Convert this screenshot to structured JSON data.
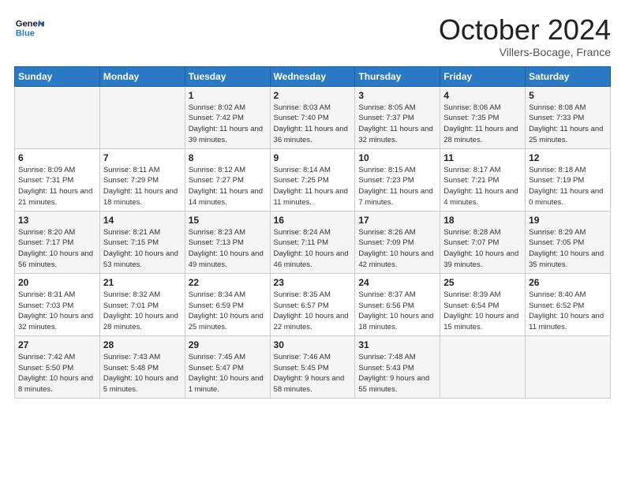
{
  "header": {
    "logo_line1": "General",
    "logo_line2": "Blue",
    "month_title": "October 2024",
    "subtitle": "Villers-Bocage, France"
  },
  "weekdays": [
    "Sunday",
    "Monday",
    "Tuesday",
    "Wednesday",
    "Thursday",
    "Friday",
    "Saturday"
  ],
  "weeks": [
    [
      {
        "day": "",
        "info": ""
      },
      {
        "day": "",
        "info": ""
      },
      {
        "day": "1",
        "info": "Sunrise: 8:02 AM\nSunset: 7:42 PM\nDaylight: 11 hours and 39 minutes."
      },
      {
        "day": "2",
        "info": "Sunrise: 8:03 AM\nSunset: 7:40 PM\nDaylight: 11 hours and 36 minutes."
      },
      {
        "day": "3",
        "info": "Sunrise: 8:05 AM\nSunset: 7:37 PM\nDaylight: 11 hours and 32 minutes."
      },
      {
        "day": "4",
        "info": "Sunrise: 8:06 AM\nSunset: 7:35 PM\nDaylight: 11 hours and 28 minutes."
      },
      {
        "day": "5",
        "info": "Sunrise: 8:08 AM\nSunset: 7:33 PM\nDaylight: 11 hours and 25 minutes."
      }
    ],
    [
      {
        "day": "6",
        "info": "Sunrise: 8:09 AM\nSunset: 7:31 PM\nDaylight: 11 hours and 21 minutes."
      },
      {
        "day": "7",
        "info": "Sunrise: 8:11 AM\nSunset: 7:29 PM\nDaylight: 11 hours and 18 minutes."
      },
      {
        "day": "8",
        "info": "Sunrise: 8:12 AM\nSunset: 7:27 PM\nDaylight: 11 hours and 14 minutes."
      },
      {
        "day": "9",
        "info": "Sunrise: 8:14 AM\nSunset: 7:25 PM\nDaylight: 11 hours and 11 minutes."
      },
      {
        "day": "10",
        "info": "Sunrise: 8:15 AM\nSunset: 7:23 PM\nDaylight: 11 hours and 7 minutes."
      },
      {
        "day": "11",
        "info": "Sunrise: 8:17 AM\nSunset: 7:21 PM\nDaylight: 11 hours and 4 minutes."
      },
      {
        "day": "12",
        "info": "Sunrise: 8:18 AM\nSunset: 7:19 PM\nDaylight: 11 hours and 0 minutes."
      }
    ],
    [
      {
        "day": "13",
        "info": "Sunrise: 8:20 AM\nSunset: 7:17 PM\nDaylight: 10 hours and 56 minutes."
      },
      {
        "day": "14",
        "info": "Sunrise: 8:21 AM\nSunset: 7:15 PM\nDaylight: 10 hours and 53 minutes."
      },
      {
        "day": "15",
        "info": "Sunrise: 8:23 AM\nSunset: 7:13 PM\nDaylight: 10 hours and 49 minutes."
      },
      {
        "day": "16",
        "info": "Sunrise: 8:24 AM\nSunset: 7:11 PM\nDaylight: 10 hours and 46 minutes."
      },
      {
        "day": "17",
        "info": "Sunrise: 8:26 AM\nSunset: 7:09 PM\nDaylight: 10 hours and 42 minutes."
      },
      {
        "day": "18",
        "info": "Sunrise: 8:28 AM\nSunset: 7:07 PM\nDaylight: 10 hours and 39 minutes."
      },
      {
        "day": "19",
        "info": "Sunrise: 8:29 AM\nSunset: 7:05 PM\nDaylight: 10 hours and 35 minutes."
      }
    ],
    [
      {
        "day": "20",
        "info": "Sunrise: 8:31 AM\nSunset: 7:03 PM\nDaylight: 10 hours and 32 minutes."
      },
      {
        "day": "21",
        "info": "Sunrise: 8:32 AM\nSunset: 7:01 PM\nDaylight: 10 hours and 28 minutes."
      },
      {
        "day": "22",
        "info": "Sunrise: 8:34 AM\nSunset: 6:59 PM\nDaylight: 10 hours and 25 minutes."
      },
      {
        "day": "23",
        "info": "Sunrise: 8:35 AM\nSunset: 6:57 PM\nDaylight: 10 hours and 22 minutes."
      },
      {
        "day": "24",
        "info": "Sunrise: 8:37 AM\nSunset: 6:56 PM\nDaylight: 10 hours and 18 minutes."
      },
      {
        "day": "25",
        "info": "Sunrise: 8:39 AM\nSunset: 6:54 PM\nDaylight: 10 hours and 15 minutes."
      },
      {
        "day": "26",
        "info": "Sunrise: 8:40 AM\nSunset: 6:52 PM\nDaylight: 10 hours and 11 minutes."
      }
    ],
    [
      {
        "day": "27",
        "info": "Sunrise: 7:42 AM\nSunset: 5:50 PM\nDaylight: 10 hours and 8 minutes."
      },
      {
        "day": "28",
        "info": "Sunrise: 7:43 AM\nSunset: 5:48 PM\nDaylight: 10 hours and 5 minutes."
      },
      {
        "day": "29",
        "info": "Sunrise: 7:45 AM\nSunset: 5:47 PM\nDaylight: 10 hours and 1 minute."
      },
      {
        "day": "30",
        "info": "Sunrise: 7:46 AM\nSunset: 5:45 PM\nDaylight: 9 hours and 58 minutes."
      },
      {
        "day": "31",
        "info": "Sunrise: 7:48 AM\nSunset: 5:43 PM\nDaylight: 9 hours and 55 minutes."
      },
      {
        "day": "",
        "info": ""
      },
      {
        "day": "",
        "info": ""
      }
    ]
  ]
}
